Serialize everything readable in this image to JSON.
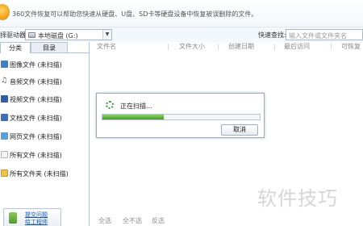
{
  "banner": {
    "text": "360文件恢复可以帮助您快速从硬盘、U盘、SD卡等硬盘设备中恢复被误删除的文件。"
  },
  "toolbar": {
    "drive_label": "择驱动器:",
    "drive_value": "本地磁盘 (G:)",
    "search_label": "快速查找:",
    "search_placeholder": "输入文件或文件夹名"
  },
  "sidebar": {
    "tabs": [
      {
        "label": "分类"
      },
      {
        "label": "目录"
      }
    ],
    "categories": [
      {
        "label": "图像文件 (未扫描)",
        "icon": "image-file-icon",
        "color": "#3f7fc7"
      },
      {
        "label": "音频文件 (未扫描)",
        "icon": "music-note-icon",
        "color": "#4b4b4b"
      },
      {
        "label": "视频文件 (未扫描)",
        "icon": "video-file-icon",
        "color": "#2e5fa8"
      },
      {
        "label": "文档文件 (未扫描)",
        "icon": "document-file-icon",
        "color": "#3d6fb8"
      },
      {
        "label": "网页文件 (未扫描)",
        "icon": "web-page-icon",
        "color": "#5a9fd8"
      },
      {
        "label": "所有文件 (未扫描)",
        "icon": "all-files-icon",
        "color": "#eaeaea"
      },
      {
        "label": "所有文件夹 (未扫描)",
        "icon": "folder-icon",
        "color": "#f0c24a"
      }
    ],
    "help_button": {
      "label": "提交问题\n给工程师"
    }
  },
  "main": {
    "columns": [
      {
        "label": "文件名"
      },
      {
        "label": "文件大小"
      },
      {
        "label": "创建日期"
      },
      {
        "label": "最后访问"
      },
      {
        "label": "可恢复"
      }
    ],
    "footer": {
      "select_all": "全选",
      "select_none": "全不选",
      "invert": "反选"
    }
  },
  "dialog": {
    "status": "正在扫描...",
    "progress_percent": 39,
    "cancel_label": "取消"
  },
  "watermark": {
    "text": "软件技巧"
  },
  "colors": {
    "accent_green": "#3f9a27",
    "link_blue": "#1a56a6",
    "border": "#b5c3d2"
  }
}
